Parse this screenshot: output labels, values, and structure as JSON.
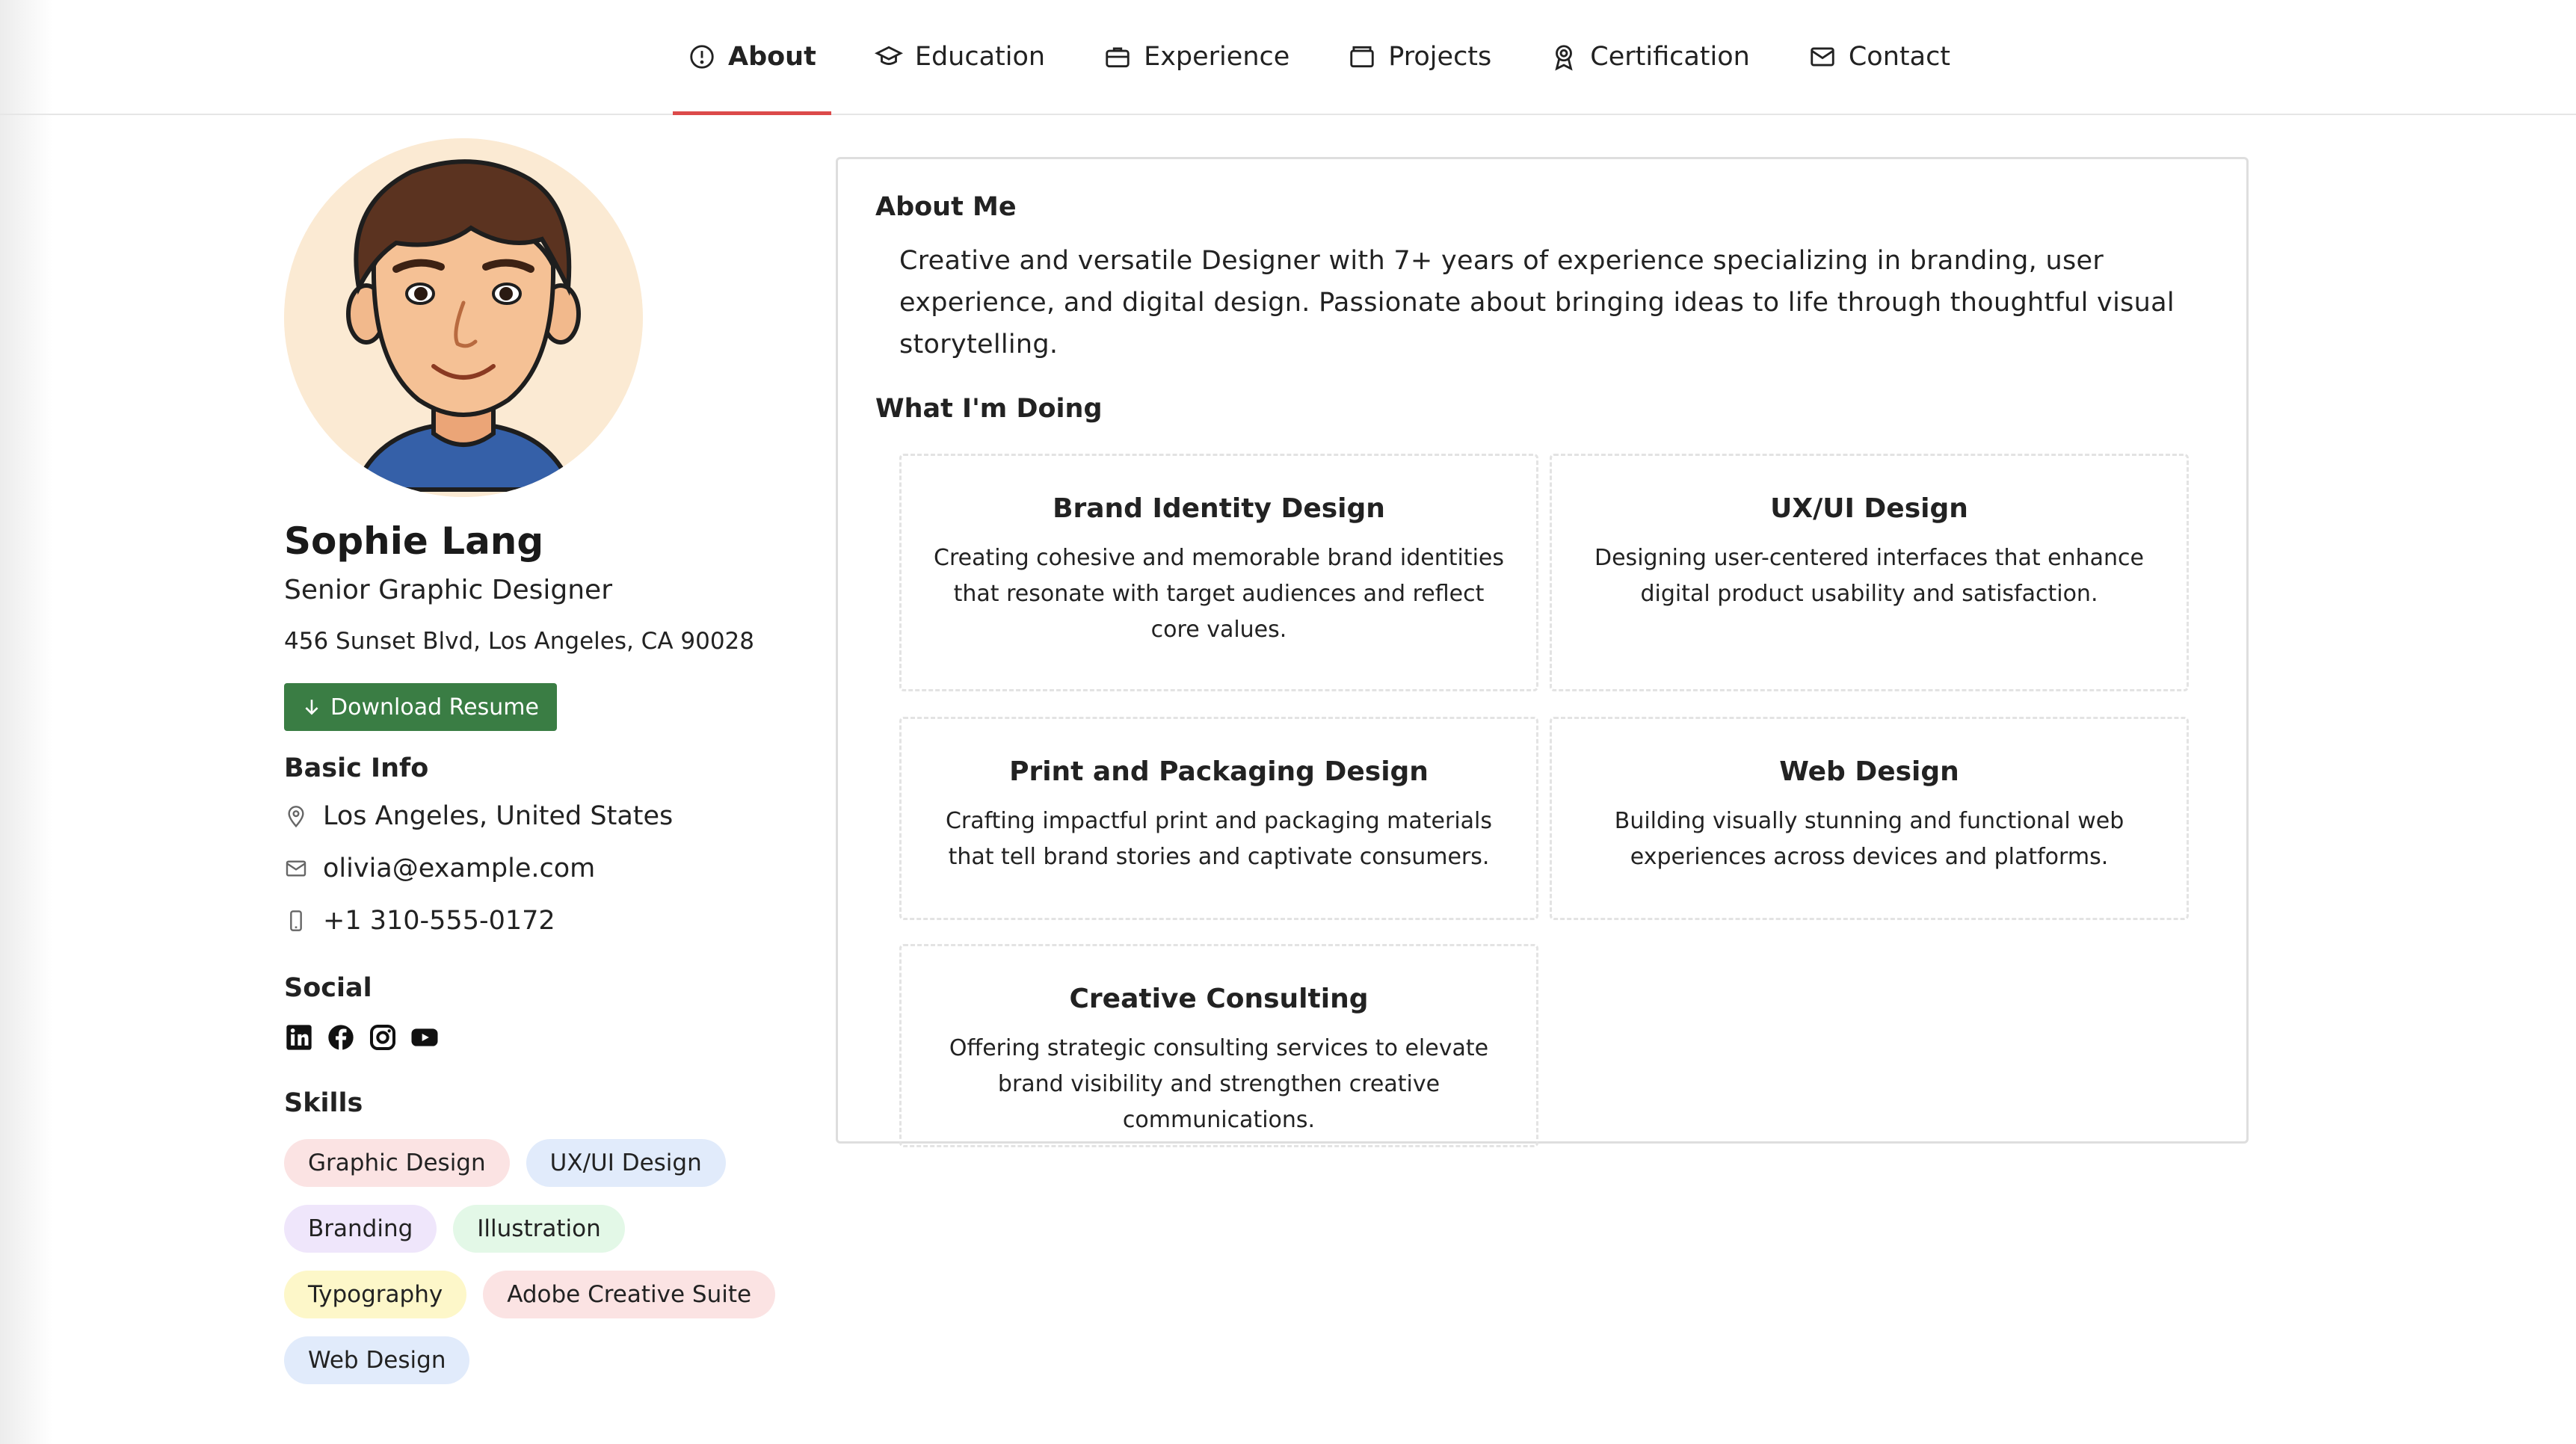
{
  "nav": {
    "tabs": [
      {
        "label": "About",
        "icon": "info-icon",
        "active": true
      },
      {
        "label": "Education",
        "icon": "graduation-cap-icon",
        "active": false
      },
      {
        "label": "Experience",
        "icon": "briefcase-icon",
        "active": false
      },
      {
        "label": "Projects",
        "icon": "folder-icon",
        "active": false
      },
      {
        "label": "Certification",
        "icon": "award-icon",
        "active": false
      },
      {
        "label": "Contact",
        "icon": "mail-icon",
        "active": false
      }
    ],
    "active_color": "#dc4a4a"
  },
  "profile": {
    "name": "Sophie Lang",
    "title": "Senior Graphic Designer",
    "address": "456 Sunset Blvd, Los Angeles, CA 90028",
    "download_label": "Download Resume",
    "download_color": "#3a7d44"
  },
  "basic_info": {
    "title": "Basic Info",
    "location": "Los Angeles, United States",
    "email": "olivia@example.com",
    "phone": "+1 310-555-0172"
  },
  "social": {
    "title": "Social",
    "icons": [
      "linkedin-icon",
      "facebook-icon",
      "instagram-icon",
      "youtube-icon"
    ]
  },
  "skills": {
    "title": "Skills",
    "items": [
      {
        "label": "Graphic Design",
        "color": "#fbe3e3"
      },
      {
        "label": "UX/UI Design",
        "color": "#e1ebfb"
      },
      {
        "label": "Branding",
        "color": "#efe6fb"
      },
      {
        "label": "Illustration",
        "color": "#e3f8e7"
      },
      {
        "label": "Typography",
        "color": "#fdf7c9"
      },
      {
        "label": "Adobe Creative Suite",
        "color": "#fbe3e3"
      },
      {
        "label": "Web Design",
        "color": "#e1ebfb"
      }
    ]
  },
  "about": {
    "title": "About Me",
    "text": "Creative and versatile Designer with 7+ years of experience specializing in branding, user experience, and digital design. Passionate about bringing ideas to life through thoughtful visual storytelling.",
    "doing_title": "What I'm Doing",
    "services": [
      {
        "title": "Brand Identity Design",
        "desc": "Creating cohesive and memorable brand identities that resonate with target audiences and reflect core values."
      },
      {
        "title": "UX/UI Design",
        "desc": "Designing user-centered interfaces that enhance digital product usability and satisfaction."
      },
      {
        "title": "Print and Packaging Design",
        "desc": "Crafting impactful print and packaging materials that tell brand stories and captivate consumers."
      },
      {
        "title": "Web Design",
        "desc": "Building visually stunning and functional web experiences across devices and platforms."
      },
      {
        "title": "Creative Consulting",
        "desc": "Offering strategic consulting services to elevate brand visibility and strengthen creative communications."
      }
    ]
  }
}
